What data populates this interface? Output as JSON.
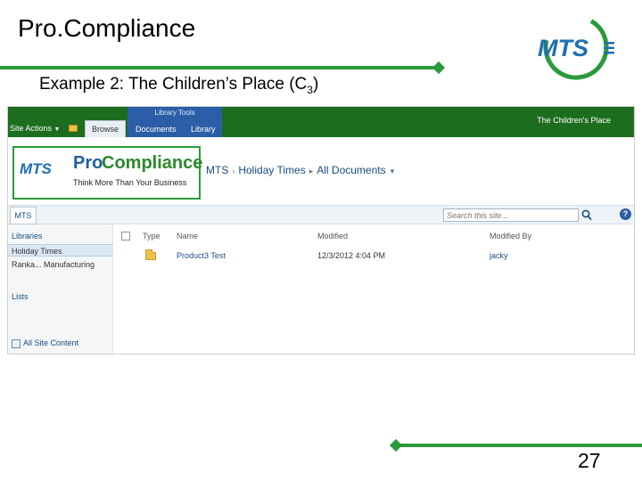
{
  "slide": {
    "title": "Pro.Compliance",
    "subtitle_main": "Example 2: The Children’s Place (C",
    "subtitle_sub": "3",
    "subtitle_end": ")",
    "page_number": "27",
    "logo_text": "MTS",
    "accent_color": "#2a9a3a",
    "logo_blue": "#1f6fb2"
  },
  "sharepoint": {
    "ribbon": {
      "site_actions": "Site Actions",
      "context_group": "Library Tools",
      "tab_browse": "Browse",
      "tab_documents": "Documents",
      "tab_library": "Library",
      "site_name": "The Children's Place",
      "ribbon_color": "#1d6d1f",
      "context_color": "#2b5ea6"
    },
    "logo": {
      "mts": "MTS",
      "pro": "Pro",
      "compliance": "Compliance",
      "tagline": "Think More Than Your Business"
    },
    "breadcrumb": {
      "site": "MTS",
      "list": "Holiday Times",
      "view": "All Documents"
    },
    "nav": {
      "tab": "MTS",
      "search_placeholder": "Search this site...",
      "help": "?"
    },
    "quicklaunch": {
      "libraries_heading": "Libraries",
      "items": [
        "Holiday Times",
        "Ranka... Manufacturing"
      ],
      "lists_heading": "Lists",
      "all_site_content": "All Site Content"
    },
    "list": {
      "columns": [
        "Type",
        "Name",
        "Modified",
        "Modified By"
      ],
      "rows": [
        {
          "type_icon": "folder-icon",
          "name": "Product3 Test",
          "modified": "12/3/2012 4:04 PM",
          "modified_by": "jacky"
        }
      ]
    }
  }
}
